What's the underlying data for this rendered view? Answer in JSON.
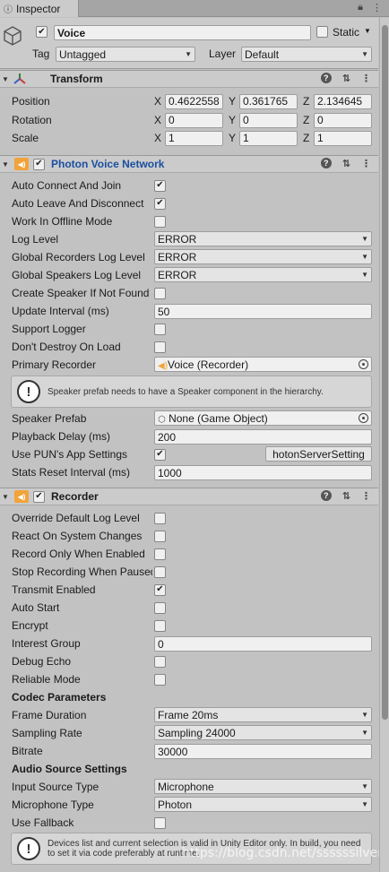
{
  "tab": {
    "title": "Inspector"
  },
  "object": {
    "name": "Voice",
    "active": true,
    "static_label": "Static",
    "tag_label": "Tag",
    "tag_value": "Untagged",
    "layer_label": "Layer",
    "layer_value": "Default"
  },
  "transform": {
    "title": "Transform",
    "position_label": "Position",
    "rotation_label": "Rotation",
    "scale_label": "Scale",
    "axis_x": "X",
    "axis_y": "Y",
    "axis_z": "Z",
    "position": {
      "x": "0.4622558",
      "y": "0.361765",
      "z": "2.134645"
    },
    "rotation": {
      "x": "0",
      "y": "0",
      "z": "0"
    },
    "scale": {
      "x": "1",
      "y": "1",
      "z": "1"
    }
  },
  "pvn": {
    "title": "Photon Voice Network",
    "rows": {
      "auto_connect": "Auto Connect And Join",
      "auto_leave": "Auto Leave And Disconnect",
      "offline": "Work In Offline Mode",
      "log_level": "Log Level",
      "recorders_log": "Global Recorders Log Level",
      "speakers_log": "Global Speakers Log Level",
      "create_speaker": "Create Speaker If Not Found",
      "update_interval": "Update Interval (ms)",
      "support_logger": "Support Logger",
      "dont_destroy": "Don't Destroy On Load",
      "primary_recorder": "Primary Recorder",
      "speaker_prefab": "Speaker Prefab",
      "playback_delay": "Playback Delay (ms)",
      "use_pun": "Use PUN's App Settings",
      "stats_reset": "Stats Reset Interval (ms)"
    },
    "values": {
      "log_level": "ERROR",
      "recorders_log": "ERROR",
      "speakers_log": "ERROR",
      "update_interval": "50",
      "primary_recorder": "Voice (Recorder)",
      "speaker_prefab": "None (Game Object)",
      "playback_delay": "200",
      "pun_settings_button": "hotonServerSetting",
      "stats_reset": "1000"
    },
    "help": "Speaker prefab needs to have a Speaker component in the hierarchy."
  },
  "recorder": {
    "title": "Recorder",
    "rows": {
      "override_log": "Override Default Log Level",
      "react_changes": "React On System Changes",
      "record_only": "Record Only When Enabled",
      "stop_pause": "Stop Recording When Paused",
      "transmit": "Transmit Enabled",
      "auto_start": "Auto Start",
      "encrypt": "Encrypt",
      "interest_group": "Interest Group",
      "debug_echo": "Debug Echo",
      "reliable": "Reliable Mode",
      "codec_section": "Codec Parameters",
      "frame_duration": "Frame Duration",
      "sampling_rate": "Sampling Rate",
      "bitrate": "Bitrate",
      "audio_section": "Audio Source Settings",
      "input_source": "Input Source Type",
      "mic_type": "Microphone Type",
      "use_fallback": "Use Fallback"
    },
    "values": {
      "interest_group": "0",
      "frame_duration": "Frame 20ms",
      "sampling_rate": "Sampling 24000",
      "bitrate": "30000",
      "input_source": "Microphone",
      "mic_type": "Photon"
    },
    "help": "Devices list and current selection is valid in Unity Editor only. In build, you need to set it via code preferably at runtime."
  },
  "watermark": "https://blog.csdn.net/ssssssilver",
  "colors": {
    "accent_link": "#1a4fa0",
    "component_icon": "#f2a33a"
  },
  "icons": [
    "cube-icon",
    "help-icon",
    "preset-icon",
    "kebab-icon",
    "lock-icon",
    "object-picker-icon",
    "warning-icon"
  ]
}
